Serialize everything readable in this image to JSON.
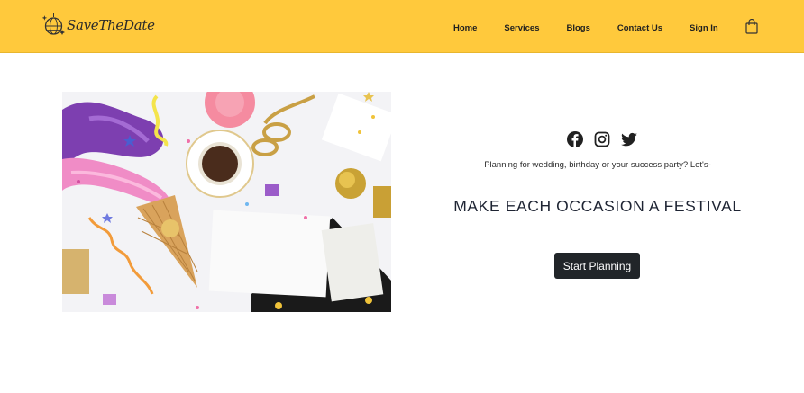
{
  "brand": {
    "name": "SaveTheDate",
    "logo_icon": "disco-ball-icon"
  },
  "nav": {
    "links": [
      {
        "label": "Home"
      },
      {
        "label": "Services"
      },
      {
        "label": "Blogs"
      },
      {
        "label": "Contact Us"
      },
      {
        "label": "Sign In"
      }
    ],
    "cart_icon": "shopping-bag-icon"
  },
  "colors": {
    "navbar_bg": "#ffc93c",
    "button_bg": "#212529",
    "button_text": "#ffffff",
    "headline_text": "#1e2433"
  },
  "hero": {
    "image_subject": "party-flatlay-image",
    "social_icons": [
      "facebook-icon",
      "instagram-icon",
      "twitter-icon"
    ],
    "tagline": "Planning for wedding, birthday or your success party? Let's-",
    "headline": "MAKE EACH OCCASION A FESTIVAL",
    "cta_label": "Start Planning"
  }
}
